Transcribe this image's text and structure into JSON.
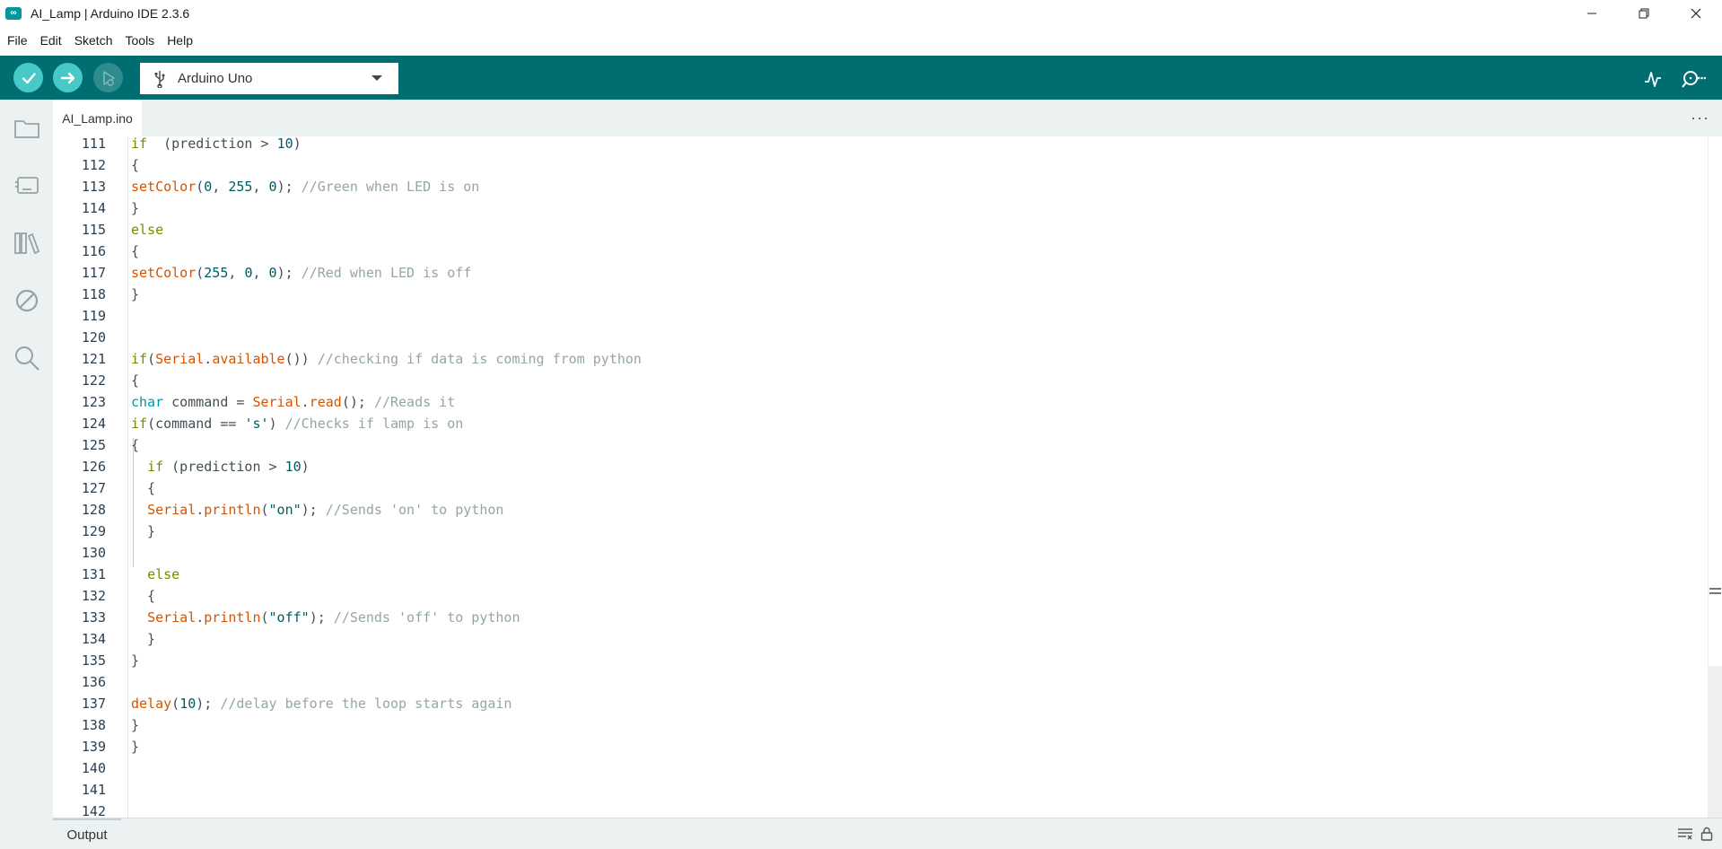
{
  "window": {
    "title": "AI_Lamp | Arduino IDE 2.3.6",
    "logo_glyph": "∞"
  },
  "menu": [
    "File",
    "Edit",
    "Sketch",
    "Tools",
    "Help"
  ],
  "toolbar": {
    "board": "Arduino Uno",
    "accent_color": "#006d70",
    "button_color": "#47c9c9"
  },
  "sidebar": {
    "icons": [
      "folder-icon",
      "board-icon",
      "library-icon",
      "debug-icon",
      "search-icon"
    ]
  },
  "tab": {
    "filename": "AI_Lamp.ino",
    "more": "···"
  },
  "code": {
    "lines": [
      {
        "no": "111",
        "tokens": [
          [
            "kw",
            "if"
          ],
          [
            "",
            "  (prediction > "
          ],
          [
            "num",
            "10"
          ],
          [
            "",
            ")"
          ]
        ]
      },
      {
        "no": "112",
        "tokens": [
          [
            "",
            "{"
          ]
        ]
      },
      {
        "no": "113",
        "tokens": [
          [
            "fn",
            "setColor"
          ],
          [
            "",
            "("
          ],
          [
            "num",
            "0"
          ],
          [
            "",
            ", "
          ],
          [
            "num",
            "255"
          ],
          [
            "",
            ", "
          ],
          [
            "num",
            "0"
          ],
          [
            "",
            "); "
          ],
          [
            "cm",
            "//Green when LED is on"
          ]
        ]
      },
      {
        "no": "114",
        "tokens": [
          [
            "",
            "}"
          ]
        ]
      },
      {
        "no": "115",
        "tokens": [
          [
            "kw",
            "else"
          ]
        ]
      },
      {
        "no": "116",
        "tokens": [
          [
            "",
            "{"
          ]
        ]
      },
      {
        "no": "117",
        "tokens": [
          [
            "fn",
            "setColor"
          ],
          [
            "",
            "("
          ],
          [
            "num",
            "255"
          ],
          [
            "",
            ", "
          ],
          [
            "num",
            "0"
          ],
          [
            "",
            ", "
          ],
          [
            "num",
            "0"
          ],
          [
            "",
            "); "
          ],
          [
            "cm",
            "//Red when LED is off"
          ]
        ]
      },
      {
        "no": "118",
        "tokens": [
          [
            "",
            "}"
          ]
        ]
      },
      {
        "no": "119",
        "tokens": []
      },
      {
        "no": "120",
        "tokens": []
      },
      {
        "no": "121",
        "tokens": [
          [
            "kw",
            "if"
          ],
          [
            "",
            "("
          ],
          [
            "fn",
            "Serial"
          ],
          [
            "",
            "."
          ],
          [
            "fn",
            "available"
          ],
          [
            "",
            "()) "
          ],
          [
            "cm",
            "//checking if data is coming from python"
          ]
        ]
      },
      {
        "no": "122",
        "tokens": [
          [
            "",
            "{"
          ]
        ]
      },
      {
        "no": "123",
        "tokens": [
          [
            "tp",
            "char"
          ],
          [
            "",
            " command = "
          ],
          [
            "fn",
            "Serial"
          ],
          [
            "",
            "."
          ],
          [
            "fn",
            "read"
          ],
          [
            "",
            "(); "
          ],
          [
            "cm",
            "//Reads it"
          ]
        ]
      },
      {
        "no": "124",
        "tokens": [
          [
            "kw",
            "if"
          ],
          [
            "",
            "(command == "
          ],
          [
            "str",
            "'s'"
          ],
          [
            "",
            ") "
          ],
          [
            "cm",
            "//Checks if lamp is on"
          ]
        ]
      },
      {
        "no": "125",
        "tokens": [
          [
            "",
            "{"
          ]
        ]
      },
      {
        "no": "126",
        "tokens": [
          [
            "",
            "  "
          ],
          [
            "kw",
            "if"
          ],
          [
            "",
            " (prediction > "
          ],
          [
            "num",
            "10"
          ],
          [
            "",
            ")"
          ]
        ]
      },
      {
        "no": "127",
        "tokens": [
          [
            "",
            "  {"
          ]
        ]
      },
      {
        "no": "128",
        "tokens": [
          [
            "",
            "  "
          ],
          [
            "fn",
            "Serial"
          ],
          [
            "",
            "."
          ],
          [
            "fn",
            "println"
          ],
          [
            "",
            "("
          ],
          [
            "str",
            "\"on\""
          ],
          [
            "",
            "); "
          ],
          [
            "cm",
            "//Sends 'on' to python"
          ]
        ]
      },
      {
        "no": "129",
        "tokens": [
          [
            "",
            "  }"
          ]
        ]
      },
      {
        "no": "130",
        "tokens": []
      },
      {
        "no": "131",
        "tokens": [
          [
            "",
            "  "
          ],
          [
            "kw",
            "else"
          ]
        ]
      },
      {
        "no": "132",
        "tokens": [
          [
            "",
            "  {"
          ]
        ]
      },
      {
        "no": "133",
        "tokens": [
          [
            "",
            "  "
          ],
          [
            "fn",
            "Serial"
          ],
          [
            "",
            "."
          ],
          [
            "fn",
            "println"
          ],
          [
            "",
            "("
          ],
          [
            "str",
            "\"off\""
          ],
          [
            "",
            "); "
          ],
          [
            "cm",
            "//Sends 'off' to python"
          ]
        ]
      },
      {
        "no": "134",
        "tokens": [
          [
            "",
            "  }"
          ]
        ]
      },
      {
        "no": "135",
        "tokens": [
          [
            "",
            "}"
          ]
        ]
      },
      {
        "no": "136",
        "tokens": []
      },
      {
        "no": "137",
        "tokens": [
          [
            "fn",
            "delay"
          ],
          [
            "",
            "("
          ],
          [
            "num",
            "10"
          ],
          [
            "",
            "); "
          ],
          [
            "cm",
            "//delay before the loop starts again"
          ]
        ]
      },
      {
        "no": "138",
        "tokens": [
          [
            "",
            "}"
          ]
        ]
      },
      {
        "no": "139",
        "tokens": [
          [
            "",
            "}"
          ]
        ]
      },
      {
        "no": "140",
        "tokens": []
      },
      {
        "no": "141",
        "tokens": []
      },
      {
        "no": "142",
        "tokens": []
      }
    ]
  },
  "output": {
    "label": "Output"
  }
}
